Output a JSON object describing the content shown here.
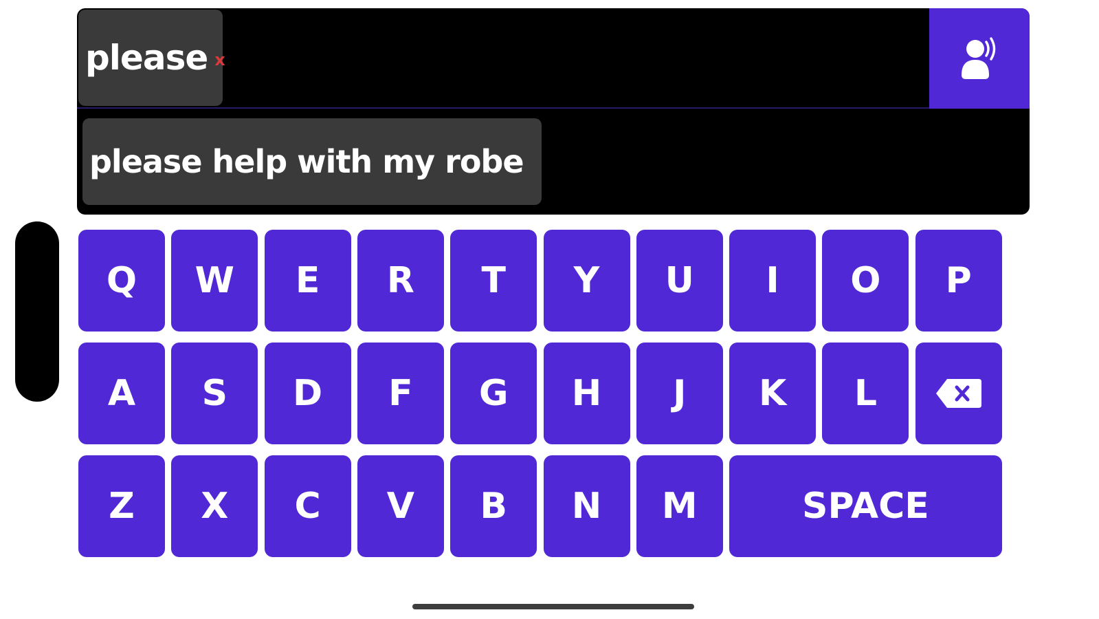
{
  "input": {
    "chips": [
      {
        "word": "please",
        "remove_label": "x"
      }
    ]
  },
  "speak_button": {
    "icon": "speaker-person-icon"
  },
  "suggestions": [
    "please help with my robe"
  ],
  "keyboard": {
    "rows": [
      [
        "Q",
        "W",
        "E",
        "R",
        "T",
        "Y",
        "U",
        "I",
        "O",
        "P"
      ],
      [
        "A",
        "S",
        "D",
        "F",
        "G",
        "H",
        "J",
        "K",
        "L"
      ],
      [
        "Z",
        "X",
        "C",
        "V",
        "B",
        "N",
        "M"
      ]
    ],
    "backspace_icon": "backspace-icon",
    "space_label": "SPACE"
  },
  "colors": {
    "accent": "#5028d6",
    "panel": "#000000",
    "chip": "#3a3a3a",
    "remove": "#d93a3a"
  }
}
